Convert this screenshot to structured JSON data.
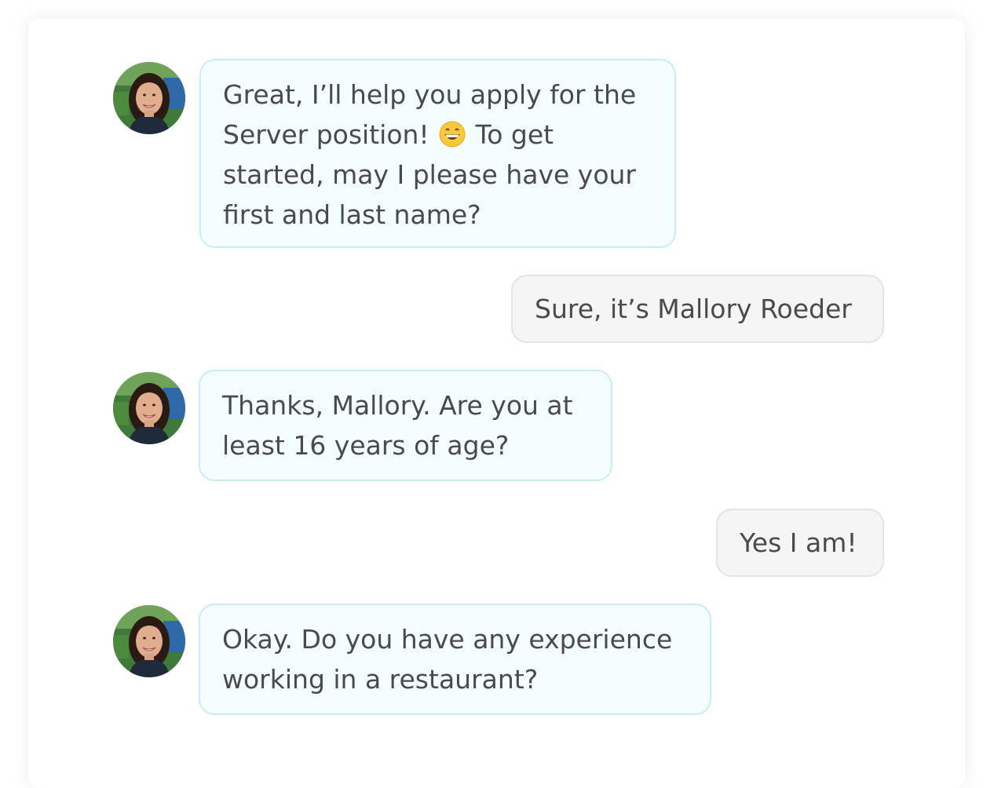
{
  "chat": {
    "messages": [
      {
        "sender": "bot",
        "lines": [
          "Great, I’ll help you apply for the",
          "Server position!",
          "To get",
          "started, may I please have your",
          "first and last name?"
        ],
        "emoji": "grinning-face-icon"
      },
      {
        "sender": "user",
        "text": "Sure, it’s Mallory Roeder"
      },
      {
        "sender": "bot",
        "lines": [
          "Thanks, Mallory. Are you at",
          "least 16 years of age?"
        ]
      },
      {
        "sender": "user",
        "text": "Yes I am!"
      },
      {
        "sender": "bot",
        "lines": [
          "Okay. Do you have any experience",
          "working in a restaurant?"
        ]
      }
    ]
  },
  "colors": {
    "bot_bubble_bg": "#f4fefe",
    "bot_bubble_border": "#c7eef0",
    "user_bubble_bg": "#f5f5f5",
    "user_bubble_border": "#e4e4e4",
    "text": "#4a4a4a"
  }
}
